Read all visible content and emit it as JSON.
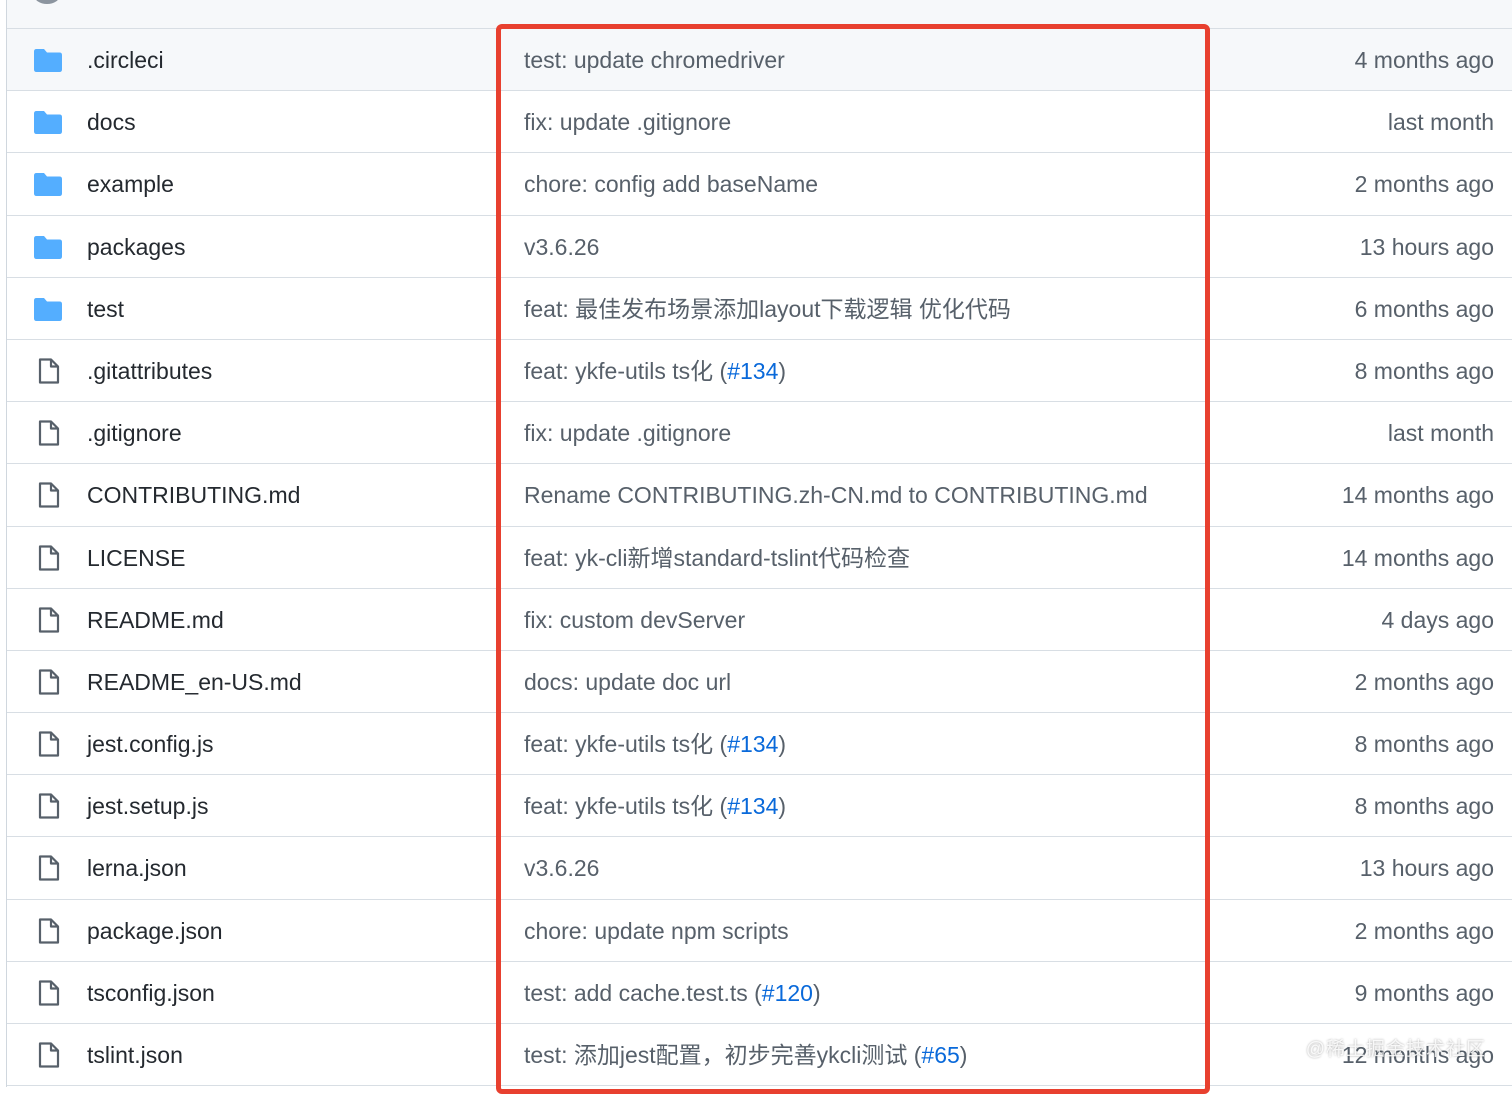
{
  "colors": {
    "folder_icon": "#54aeff",
    "file_icon": "#57606a",
    "link": "#0969da",
    "highlight_border": "#e8402f"
  },
  "files": [
    {
      "name": ".circleci",
      "type": "folder",
      "message": "test: update chromedriver",
      "pr": "",
      "msg_suffix": "",
      "age": "4 months ago"
    },
    {
      "name": "docs",
      "type": "folder",
      "message": "fix: update .gitignore",
      "pr": "",
      "msg_suffix": "",
      "age": "last month"
    },
    {
      "name": "example",
      "type": "folder",
      "message": "chore: config add baseName",
      "pr": "",
      "msg_suffix": "",
      "age": "2 months ago"
    },
    {
      "name": "packages",
      "type": "folder",
      "message": "v3.6.26",
      "pr": "",
      "msg_suffix": "",
      "age": "13 hours ago"
    },
    {
      "name": "test",
      "type": "folder",
      "message": "feat: 最佳发布场景添加layout下载逻辑 优化代码",
      "pr": "",
      "msg_suffix": "",
      "age": "6 months ago"
    },
    {
      "name": ".gitattributes",
      "type": "file",
      "message": "feat: ykfe-utils ts化 (",
      "pr": "#134",
      "msg_suffix": ")",
      "age": "8 months ago"
    },
    {
      "name": ".gitignore",
      "type": "file",
      "message": "fix: update .gitignore",
      "pr": "",
      "msg_suffix": "",
      "age": "last month"
    },
    {
      "name": "CONTRIBUTING.md",
      "type": "file",
      "message": "Rename CONTRIBUTING.zh-CN.md to CONTRIBUTING.md",
      "pr": "",
      "msg_suffix": "",
      "age": "14 months ago"
    },
    {
      "name": "LICENSE",
      "type": "file",
      "message": "feat: yk-cli新增standard-tslint代码检查",
      "pr": "",
      "msg_suffix": "",
      "age": "14 months ago"
    },
    {
      "name": "README.md",
      "type": "file",
      "message": "fix: custom devServer",
      "pr": "",
      "msg_suffix": "",
      "age": "4 days ago"
    },
    {
      "name": "README_en-US.md",
      "type": "file",
      "message": "docs: update doc url",
      "pr": "",
      "msg_suffix": "",
      "age": "2 months ago"
    },
    {
      "name": "jest.config.js",
      "type": "file",
      "message": "feat: ykfe-utils ts化 (",
      "pr": "#134",
      "msg_suffix": ")",
      "age": "8 months ago"
    },
    {
      "name": "jest.setup.js",
      "type": "file",
      "message": "feat: ykfe-utils ts化 (",
      "pr": "#134",
      "msg_suffix": ")",
      "age": "8 months ago"
    },
    {
      "name": "lerna.json",
      "type": "file",
      "message": "v3.6.26",
      "pr": "",
      "msg_suffix": "",
      "age": "13 hours ago"
    },
    {
      "name": "package.json",
      "type": "file",
      "message": "chore: update npm scripts",
      "pr": "",
      "msg_suffix": "",
      "age": "2 months ago"
    },
    {
      "name": "tsconfig.json",
      "type": "file",
      "message": "test: add cache.test.ts (",
      "pr": "#120",
      "msg_suffix": ")",
      "age": "9 months ago"
    },
    {
      "name": "tslint.json",
      "type": "file",
      "message": "test: 添加jest配置，初步完善ykcli测试 (",
      "pr": "#65",
      "msg_suffix": ")",
      "age": "12 months ago"
    }
  ],
  "watermark": "@稀土掘金技术社区"
}
